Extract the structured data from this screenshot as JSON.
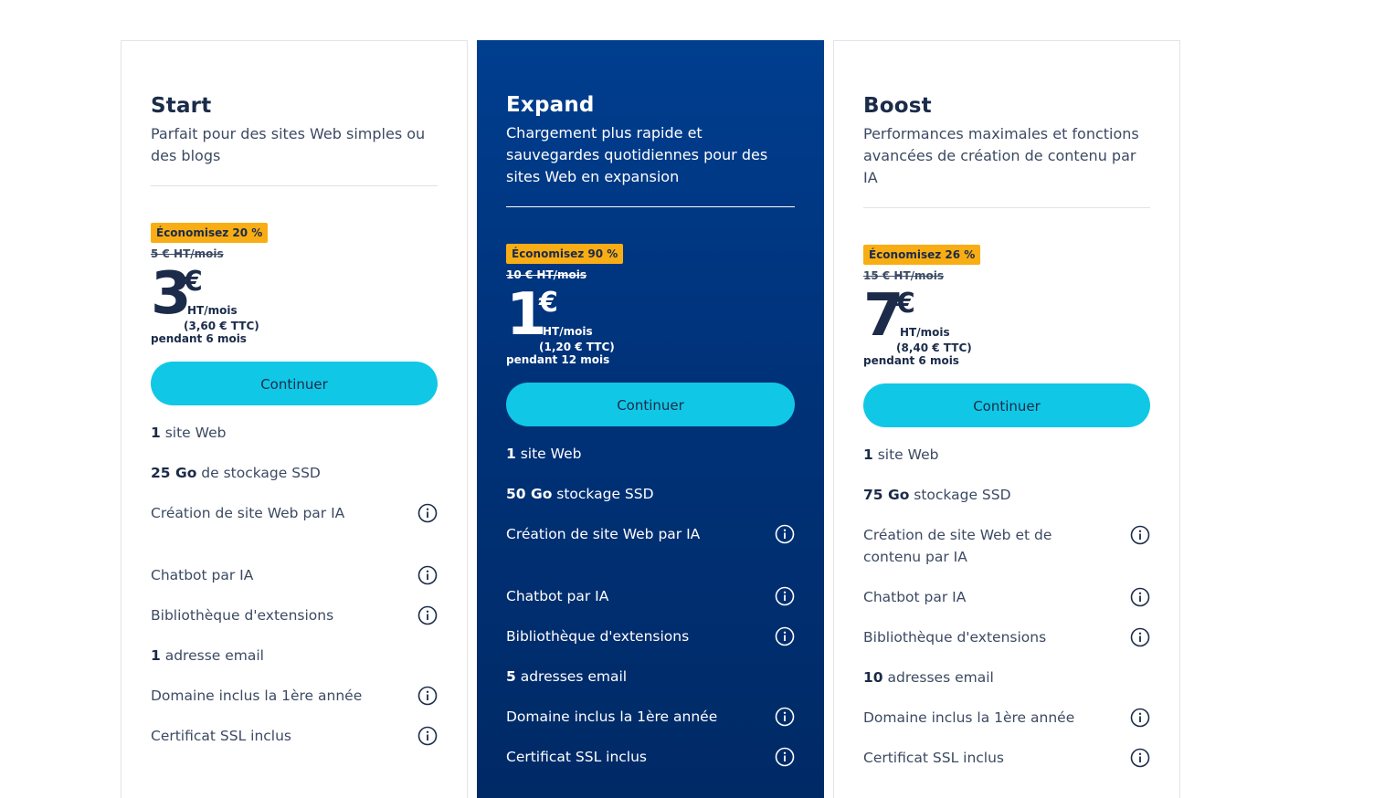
{
  "plans": [
    {
      "name": "Start",
      "description": "Parfait pour des sites Web simples ou des blogs",
      "badge": "Économisez 20 %",
      "old_price": "5 € HT/mois",
      "price": "3",
      "currency": "€",
      "price_unit": "HT/mois",
      "price_ttc": "(3,60 € TTC)",
      "period": "pendant 6 mois",
      "cta": "Continuer",
      "features": [
        {
          "bold": "1",
          "text": " site Web"
        },
        {
          "bold": "25 Go",
          "text": " de stockage SSD"
        },
        {
          "bold": "",
          "text": "Création de site Web par IA",
          "info": true
        },
        {
          "bold": "",
          "text": "Chatbot par IA",
          "info": true
        },
        {
          "bold": "",
          "text": "Bibliothèque d'extensions",
          "info": true
        },
        {
          "bold": "1",
          "text": " adresse email"
        },
        {
          "bold": "",
          "text": "Domaine inclus la 1ère année",
          "info": true
        },
        {
          "bold": "",
          "text": "Certificat SSL inclus",
          "info": true
        }
      ]
    },
    {
      "name": "Expand",
      "description": "Chargement plus rapide et sauvegardes quotidiennes pour des sites Web en expansion",
      "badge": "Économisez 90 %",
      "old_price": "10 € HT/mois",
      "price": "1",
      "currency": "€",
      "price_unit": "HT/mois",
      "price_ttc": "(1,20 € TTC)",
      "period": "pendant 12 mois",
      "cta": "Continuer",
      "features": [
        {
          "bold": "1",
          "text": " site Web"
        },
        {
          "bold": "50 Go",
          "text": " stockage SSD"
        },
        {
          "bold": "",
          "text": "Création de site Web par IA",
          "info": true
        },
        {
          "bold": "",
          "text": "Chatbot par IA",
          "info": true
        },
        {
          "bold": "",
          "text": "Bibliothèque d'extensions",
          "info": true
        },
        {
          "bold": "5",
          "text": " adresses email"
        },
        {
          "bold": "",
          "text": "Domaine inclus la 1ère année",
          "info": true
        },
        {
          "bold": "",
          "text": "Certificat SSL inclus",
          "info": true
        }
      ]
    },
    {
      "name": "Boost",
      "description": "Performances maximales et fonctions avancées de création de contenu par IA",
      "badge": "Économisez 26 %",
      "old_price": "15 € HT/mois",
      "price": "7",
      "currency": "€",
      "price_unit": "HT/mois",
      "price_ttc": "(8,40 € TTC)",
      "period": "pendant 6 mois",
      "cta": "Continuer",
      "features": [
        {
          "bold": "1",
          "text": " site Web"
        },
        {
          "bold": "75 Go",
          "text": " stockage SSD"
        },
        {
          "bold": "",
          "text": "Création de site Web et de contenu par IA",
          "info": true
        },
        {
          "bold": "",
          "text": "Chatbot par IA",
          "info": true
        },
        {
          "bold": "",
          "text": "Bibliothèque d'extensions",
          "info": true
        },
        {
          "bold": "10",
          "text": " adresses email"
        },
        {
          "bold": "",
          "text": "Domaine inclus la 1ère année",
          "info": true
        },
        {
          "bold": "",
          "text": "Certificat SSL inclus",
          "info": true
        }
      ]
    }
  ],
  "icons": {
    "info": "info-circle-icon"
  },
  "colors": {
    "featured_bg": "#003279",
    "badge_bg": "#f9ad14",
    "cta_bg": "#11c7e6",
    "text_dark": "#1b2b49"
  }
}
